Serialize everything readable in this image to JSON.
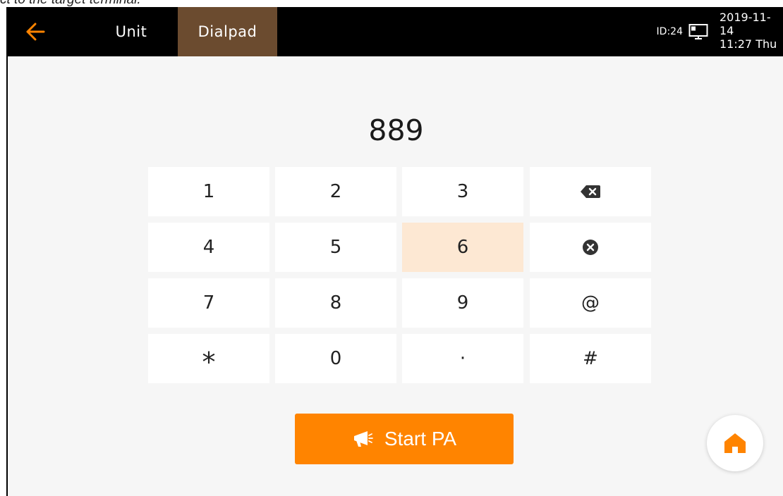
{
  "caption": {
    "text": "ct to the target terminal."
  },
  "topbar": {
    "tabs": [
      {
        "label": "Unit",
        "active": false
      },
      {
        "label": "Dialpad",
        "active": true
      }
    ],
    "status": {
      "device_id": "ID:24",
      "date": "2019-11-14",
      "time_day": "11:27 Thu"
    },
    "icons": {
      "back": "back-arrow-icon",
      "monitor": "monitor-icon"
    }
  },
  "display": {
    "number": "889"
  },
  "keypad": {
    "rows": [
      [
        "1",
        "2",
        "3",
        "backspace"
      ],
      [
        "4",
        "5",
        "6",
        "clear"
      ],
      [
        "7",
        "8",
        "9",
        "@"
      ],
      [
        "*",
        "0",
        "·",
        "#"
      ]
    ],
    "key_labels": {
      "k1": "1",
      "k2": "2",
      "k3": "3",
      "k4": "4",
      "k5": "5",
      "k6": "6",
      "k7": "7",
      "k8": "8",
      "k9": "9",
      "at": "@",
      "star": "*",
      "k0": "0",
      "dot": "·",
      "hash": "#"
    },
    "highlighted_key": "6"
  },
  "actions": {
    "start_pa": "Start PA",
    "home": "home-icon"
  },
  "colors": {
    "accent": "#ff8400",
    "topbar": "#000000",
    "active_tab": "#6b4b2f",
    "highlight_key": "#fde8d3",
    "background": "#f6f6f6"
  }
}
